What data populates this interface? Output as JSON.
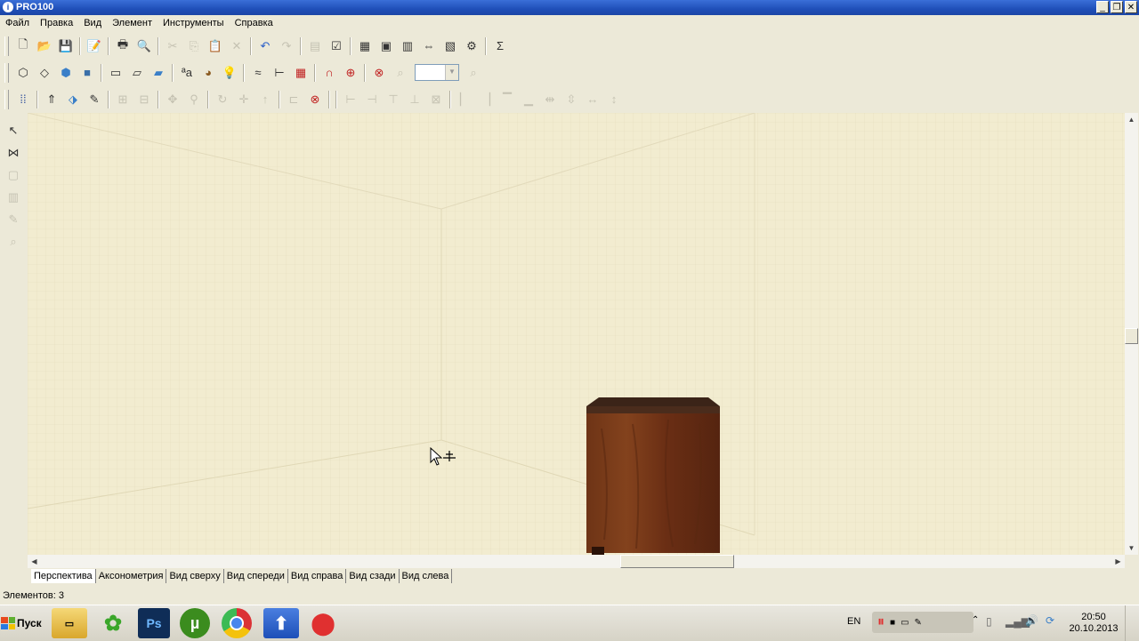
{
  "window": {
    "title": "PRO100",
    "minimize": "_",
    "restore": "❐",
    "close": "✕"
  },
  "menu": [
    "Файл",
    "Правка",
    "Вид",
    "Элемент",
    "Инструменты",
    "Справка"
  ],
  "viewport": {
    "cursor_icon": "move-cursor-icon"
  },
  "view_tabs": [
    "Перспектива",
    "Аксонометрия",
    "Вид сверху",
    "Вид спереди",
    "Вид справа",
    "Вид сзади",
    "Вид слева"
  ],
  "status": {
    "elements": "Элементов: 3"
  },
  "taskbar": {
    "start_label": "Пуск",
    "apps": [
      "explorer",
      "icq",
      "photoshop",
      "utorrent",
      "chrome",
      "upload",
      "recorder"
    ],
    "ps_label": "Ps",
    "lang": "EN",
    "time": "20:50",
    "date": "20.10.2013"
  },
  "colors": {
    "viewport": "#f2ecd0",
    "cabinet": "#6a2e14",
    "titlebar": "#1f4fb8"
  }
}
